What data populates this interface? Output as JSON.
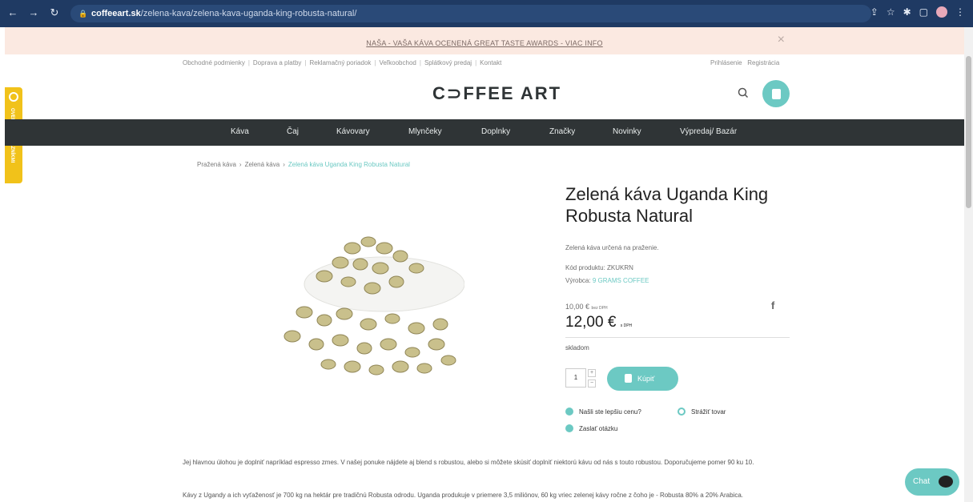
{
  "browser": {
    "url_domain": "coffeeart.sk",
    "url_path": "/zelena-kava/zelena-kava-uganda-king-robusta-natural/"
  },
  "promo": {
    "text": "NAŠA - VAŠA KÁVA OCENENÁ GREAT TASTE AWARDS - VIAC INFO",
    "close": "×"
  },
  "toplinks": {
    "items": [
      "Obchodné podmienky",
      "Doprava a platby",
      "Reklamačný poriadok",
      "Veľkoobchod",
      "Splátkový predaj",
      "Kontakt"
    ],
    "separator": "|",
    "login": "Prihlásenie",
    "register": "Registrácia"
  },
  "logo": "C⊃FFEE ART",
  "badge": "OVERENÉ ZÁKAZNÍKMI",
  "nav": [
    "Káva",
    "Čaj",
    "Kávovary",
    "Mlynčeky",
    "Doplnky",
    "Značky",
    "Novinky",
    "Výpredaj/ Bazár"
  ],
  "breadcrumb": {
    "items": [
      "Pražená káva",
      "Zelená káva"
    ],
    "current": "Zelená káva Uganda King Robusta Natural",
    "arrow": "›"
  },
  "product": {
    "title": "Zelená káva Uganda King Robusta Natural",
    "description": "Zelená káva určená na praženie.",
    "code_label": "Kód produktu: ZKUKRN",
    "maker_label": "Výrobca:",
    "maker_value": "9 GRAMS COFFEE",
    "price_net": "10,00 €",
    "price_net_suffix": "bez DPH",
    "price": "12,00 €",
    "price_suffix": "s DPH",
    "share": "f",
    "stock": "skladom",
    "qty": "1",
    "plus": "+",
    "minus": "−",
    "buy": "Kúpiť",
    "found_cheaper": "Našli ste lepšiu cenu?",
    "watch": "Strážiť tovar",
    "ask": "Zaslať otázku"
  },
  "body": {
    "p1": "Jej hlavnou úlohou je doplniť napríklad  espresso zmes. V našej ponuke nájdete aj blend s robustou, alebo si môžete skúsiť doplniť niektorú kávu od nás s touto robustou. Doporučujeme pomer 90 ku 10.",
    "p2": "Kávy z Ugandy a ich vyťaženosť je 700 kg na hektár pre tradičnú Robusta odrodu. Uganda produkuje v priemere 3,5 miliónov, 60 kg vriec zelenej kávy ročne z čoho je - Robusta 80% a 20% Arabica."
  },
  "chat": "Chat",
  "colors": {
    "accent": "#6cc9c3",
    "navbar": "#2f3436",
    "promo_bg": "#fbe9e1",
    "badge": "#f1c21a"
  }
}
